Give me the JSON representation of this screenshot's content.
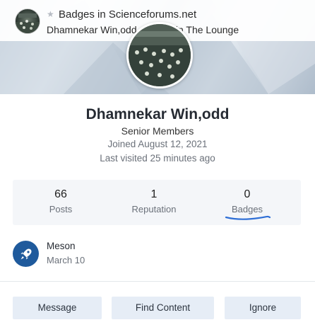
{
  "notification": {
    "title": "Badges in Scienceforums.net",
    "text": "Dhamnekar Win,odd … topic in The Lounge",
    "star_icon": "star-icon"
  },
  "profile": {
    "name": "Dhamnekar Win,odd",
    "group": "Senior Members",
    "joined": "Joined August 12, 2021",
    "last_visited": "Last visited 25 minutes ago"
  },
  "stats": [
    {
      "value": "66",
      "label": "Posts"
    },
    {
      "value": "1",
      "label": "Reputation"
    },
    {
      "value": "0",
      "label": "Badges"
    }
  ],
  "badge": {
    "name": "Meson",
    "date": "March 10",
    "icon": "rocket-icon",
    "color": "#1f5a9c"
  },
  "actions": {
    "message": "Message",
    "find_content": "Find Content",
    "ignore": "Ignore"
  },
  "colors": {
    "accent": "#1f5a9c",
    "button_bg": "#e6edf6",
    "stats_bg": "#f4f6f9",
    "underline": "#2f6fd6"
  }
}
